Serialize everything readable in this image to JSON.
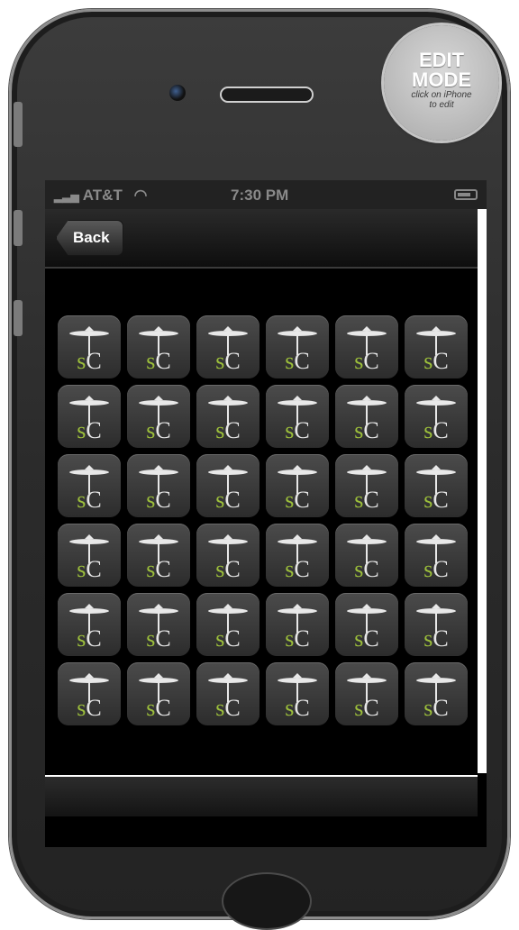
{
  "sticker": {
    "line1": "EDIT",
    "line2": "MODE",
    "note1": "click on iPhone",
    "note2": "to edit"
  },
  "status_bar": {
    "carrier": "AT&T",
    "time": "7:30 PM"
  },
  "nav": {
    "back_label": "Back"
  },
  "app_icon": {
    "s": "s",
    "c": "C",
    "icon": "sc-app-icon",
    "color_s": "#9cbf3b"
  },
  "grid": {
    "rows": 6,
    "cols": 6
  }
}
